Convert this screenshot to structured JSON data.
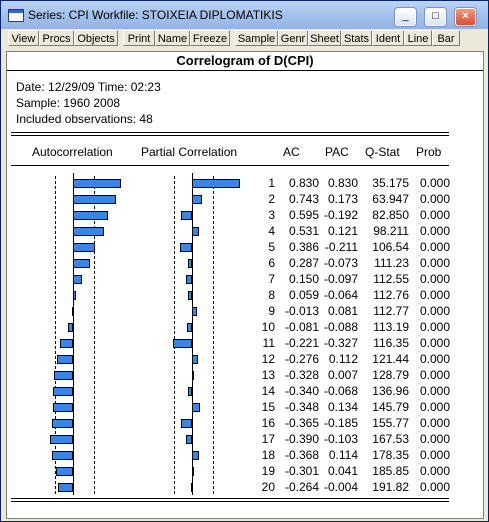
{
  "window": {
    "title": "Series: CPI   Workfile: STOIXEIA DIPLOMATIKIS",
    "buttons": {
      "minimize": "_",
      "maximize": "□",
      "close": "×"
    }
  },
  "toolbar": [
    "View",
    "Procs",
    "Objects",
    "Print",
    "Name",
    "Freeze",
    "Sample",
    "Genr",
    "Sheet",
    "Stats",
    "Ident",
    "Line",
    "Bar"
  ],
  "header": {
    "title": "Correlogram of D(CPI)",
    "date_line": "Date: 12/29/09   Time: 02:23",
    "sample_line": "Sample: 1960 2008",
    "obs_line": "Included observations: 48"
  },
  "columns": {
    "ac_graph": "Autocorrelation",
    "pac_graph": "Partial Correlation",
    "ac": "AC",
    "pac": "PAC",
    "qstat": "Q-Stat",
    "prob": "Prob"
  },
  "rows": [
    {
      "lag": "1",
      "ac": "0.830",
      "pac": "0.830",
      "q": "35.175",
      "prob": "0.000"
    },
    {
      "lag": "2",
      "ac": "0.743",
      "pac": "0.173",
      "q": "63.947",
      "prob": "0.000"
    },
    {
      "lag": "3",
      "ac": "0.595",
      "pac": "-0.192",
      "q": "82.850",
      "prob": "0.000"
    },
    {
      "lag": "4",
      "ac": "0.531",
      "pac": "0.121",
      "q": "98.211",
      "prob": "0.000"
    },
    {
      "lag": "5",
      "ac": "0.386",
      "pac": "-0.211",
      "q": "106.54",
      "prob": "0.000"
    },
    {
      "lag": "6",
      "ac": "0.287",
      "pac": "-0.073",
      "q": "111.23",
      "prob": "0.000"
    },
    {
      "lag": "7",
      "ac": "0.150",
      "pac": "-0.097",
      "q": "112.55",
      "prob": "0.000"
    },
    {
      "lag": "8",
      "ac": "0.059",
      "pac": "-0.064",
      "q": "112.76",
      "prob": "0.000"
    },
    {
      "lag": "9",
      "ac": "-0.013",
      "pac": "0.081",
      "q": "112.77",
      "prob": "0.000"
    },
    {
      "lag": "10",
      "ac": "-0.081",
      "pac": "-0.088",
      "q": "113.19",
      "prob": "0.000"
    },
    {
      "lag": "11",
      "ac": "-0.221",
      "pac": "-0.327",
      "q": "116.35",
      "prob": "0.000"
    },
    {
      "lag": "12",
      "ac": "-0.276",
      "pac": "0.112",
      "q": "121.44",
      "prob": "0.000"
    },
    {
      "lag": "13",
      "ac": "-0.328",
      "pac": "0.007",
      "q": "128.79",
      "prob": "0.000"
    },
    {
      "lag": "14",
      "ac": "-0.340",
      "pac": "-0.068",
      "q": "136.96",
      "prob": "0.000"
    },
    {
      "lag": "15",
      "ac": "-0.348",
      "pac": "0.134",
      "q": "145.79",
      "prob": "0.000"
    },
    {
      "lag": "16",
      "ac": "-0.365",
      "pac": "-0.185",
      "q": "155.77",
      "prob": "0.000"
    },
    {
      "lag": "17",
      "ac": "-0.390",
      "pac": "-0.103",
      "q": "167.53",
      "prob": "0.000"
    },
    {
      "lag": "18",
      "ac": "-0.368",
      "pac": "0.114",
      "q": "178.35",
      "prob": "0.000"
    },
    {
      "lag": "19",
      "ac": "-0.301",
      "pac": "0.041",
      "q": "185.85",
      "prob": "0.000"
    },
    {
      "lag": "20",
      "ac": "-0.264",
      "pac": "-0.004",
      "q": "191.82",
      "prob": "0.000"
    }
  ],
  "colors": {
    "bar": "#3a86e4",
    "titlebar": "#a7c3ec",
    "window_bg": "#ece9d8"
  }
}
